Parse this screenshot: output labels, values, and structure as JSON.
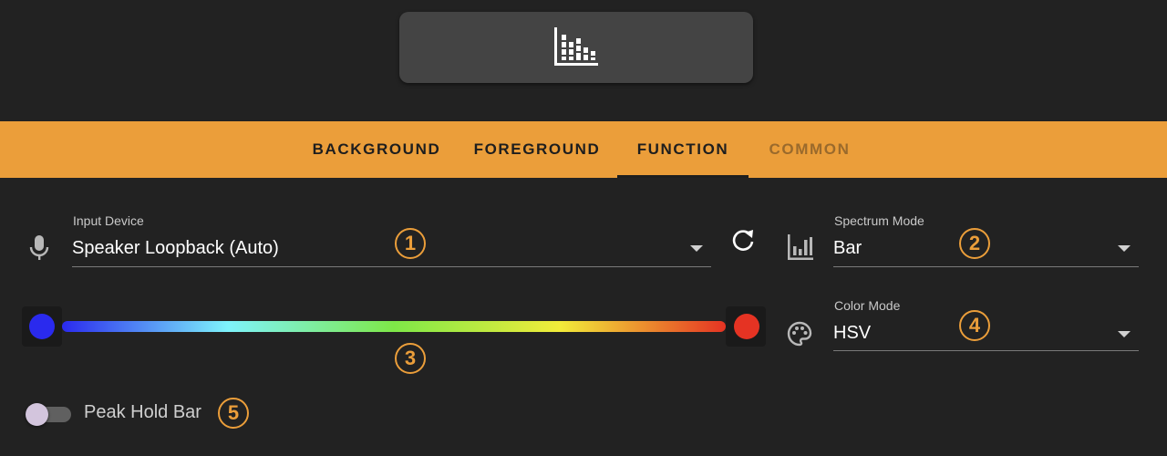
{
  "tabs": [
    {
      "label": "BACKGROUND",
      "active": false,
      "disabled": false
    },
    {
      "label": "FOREGROUND",
      "active": false,
      "disabled": false
    },
    {
      "label": "FUNCTION",
      "active": true,
      "disabled": false
    },
    {
      "label": "COMMON",
      "active": false,
      "disabled": true
    }
  ],
  "input_device": {
    "label": "Input Device",
    "value": "Speaker Loopback (Auto)",
    "icon": "microphone-icon",
    "callout": "1"
  },
  "spectrum_mode": {
    "label": "Spectrum Mode",
    "value": "Bar",
    "icon": "bar-chart-icon",
    "callout": "2"
  },
  "color_gradient": {
    "start_color": "#2a2aee",
    "end_color": "#e53323",
    "stops": [
      "#2a2aee",
      "#7ef3fb",
      "#7ee848",
      "#f2ec3a",
      "#e53323"
    ],
    "callout": "3"
  },
  "color_mode": {
    "label": "Color Mode",
    "value": "HSV",
    "icon": "palette-icon",
    "callout": "4"
  },
  "peak_hold": {
    "label": "Peak Hold Bar",
    "enabled": false,
    "callout": "5"
  },
  "colors": {
    "accent": "#eb9e3a",
    "background": "#222222",
    "button": "#444444"
  }
}
